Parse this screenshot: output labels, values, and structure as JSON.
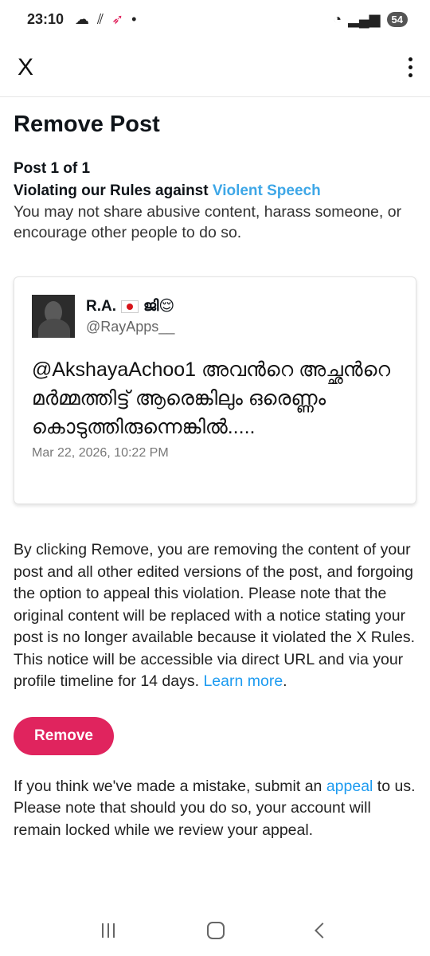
{
  "status_bar": {
    "time": "23:10",
    "battery": "54"
  },
  "app_bar": {
    "close_label": "X"
  },
  "page": {
    "title": "Remove Post",
    "post_count": "Post 1 of 1",
    "violation_prefix": "Violating our Rules against ",
    "violation_link": "Violent Speech",
    "violation_desc": "You may not share abusive content, harass someone, or encourage other people to do so."
  },
  "tweet": {
    "name": "R.A.",
    "name_suffix": "ജി😌",
    "handle": "@RayApps__",
    "text": "@AkshayaAchoo1 അവൻറെ അച്ഛൻറെ മർമ്മത്തിട്ട് ആരെങ്കിലും ഒരെണ്ണം കൊടുത്തിരുന്നെങ്കിൽ.....",
    "date": "Mar 22, 2026, 10:22 PM"
  },
  "body": {
    "text": "By clicking Remove, you are removing the content of your post and all other edited versions of the post, and forgoing the option to appeal this violation. Please note that the original content will be replaced with a notice stating your post is no longer available because it violated the X Rules. This notice will be accessible via direct URL and via your profile timeline for 14 days. ",
    "learn_more": "Learn more",
    "learn_more_suffix": "."
  },
  "actions": {
    "remove_label": "Remove"
  },
  "appeal": {
    "prefix": "If you think we've made a mistake, submit an ",
    "link": "appeal",
    "suffix": " to us. Please note that should you do so, your account will remain locked while we review your appeal."
  },
  "colors": {
    "accent_link": "#1d9bf0",
    "remove_button": "#e0245e"
  }
}
